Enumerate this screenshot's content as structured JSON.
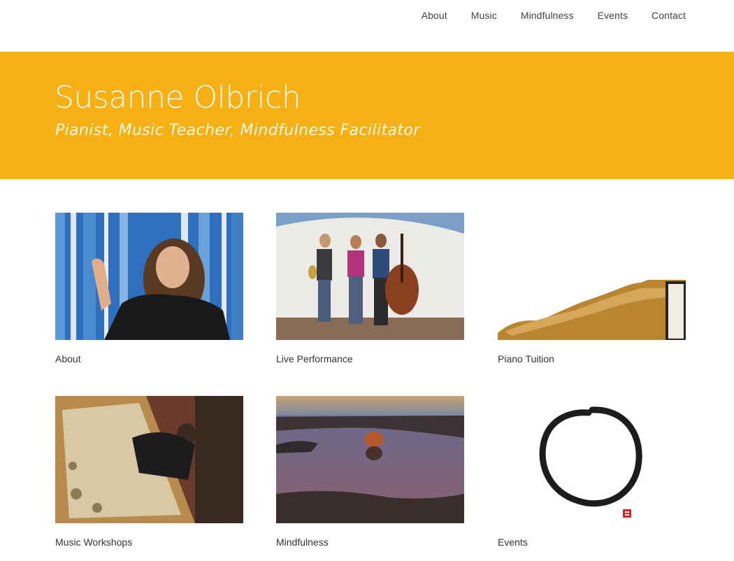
{
  "nav": {
    "items": [
      {
        "label": "About"
      },
      {
        "label": "Music"
      },
      {
        "label": "Mindfulness"
      },
      {
        "label": "Events"
      },
      {
        "label": "Contact"
      }
    ]
  },
  "hero": {
    "title": "Susanne Olbrich",
    "subtitle": "Pianist, Music Teacher, Mindfulness Facilitator",
    "background": "#f7b014"
  },
  "cards": [
    {
      "label": "About"
    },
    {
      "label": "Live Performance"
    },
    {
      "label": "Piano Tuition"
    },
    {
      "label": "Music Workshops"
    },
    {
      "label": "Mindfulness"
    },
    {
      "label": "Events"
    }
  ]
}
